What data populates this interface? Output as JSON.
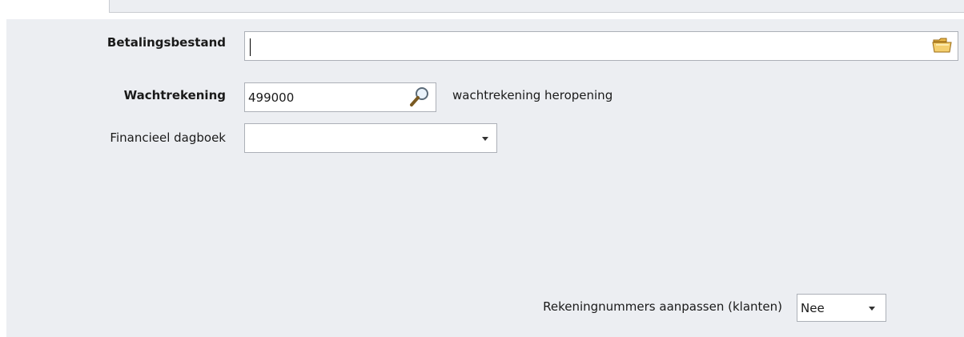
{
  "form": {
    "payment_file": {
      "label": "Betalingsbestand",
      "value": ""
    },
    "suspense_account": {
      "label": "Wachtrekening",
      "value": "499000",
      "description": "wachtrekening heropening"
    },
    "financial_journal": {
      "label": "Financieel dagboek",
      "value": ""
    },
    "adjust_accounts": {
      "label": "Rekeningnummers aanpassen (klanten)",
      "value": "Nee"
    }
  },
  "icons": {
    "payment_file_browse": "folder-icon",
    "suspense_account_lookup": "magnifier-icon",
    "dropdown": "chevron-down-icon"
  }
}
